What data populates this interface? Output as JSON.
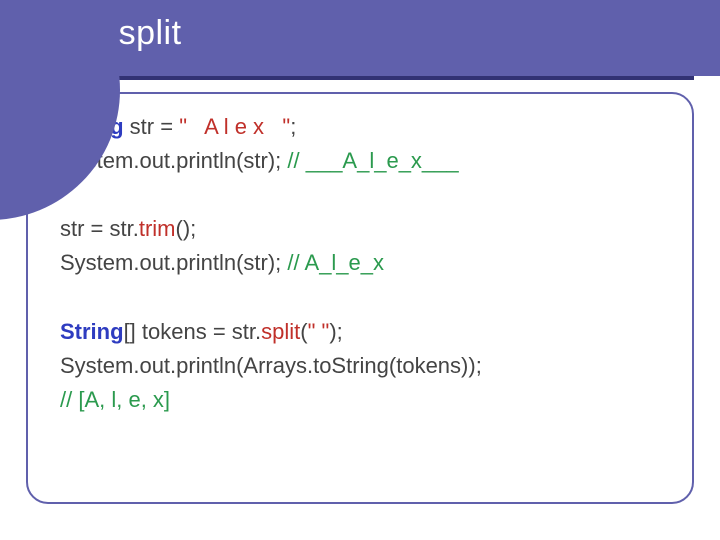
{
  "title": "Trim, split",
  "code": {
    "blank": " ",
    "l1": {
      "kw": "String",
      "a": " str = ",
      "lit": "\"   A l e x   \"",
      "b": ";"
    },
    "l2": {
      "a": "System.out.println(str); ",
      "cmt": "// ___A_l_e_x___"
    },
    "l3": {
      "a": "str = str.",
      "mth": "trim",
      "b": "();"
    },
    "l4": {
      "a": "System.out.println(str); ",
      "cmt": "// A_l_e_x"
    },
    "l5": {
      "kw": "String",
      "a": "[] tokens = str.",
      "mth": "split",
      "b": "(",
      "lit": "\" \"",
      "c": ");"
    },
    "l6": {
      "a": "System.out.println(Arrays.toString(tokens));"
    },
    "l7": {
      "cmt": "// [A, l, e, x]"
    }
  }
}
